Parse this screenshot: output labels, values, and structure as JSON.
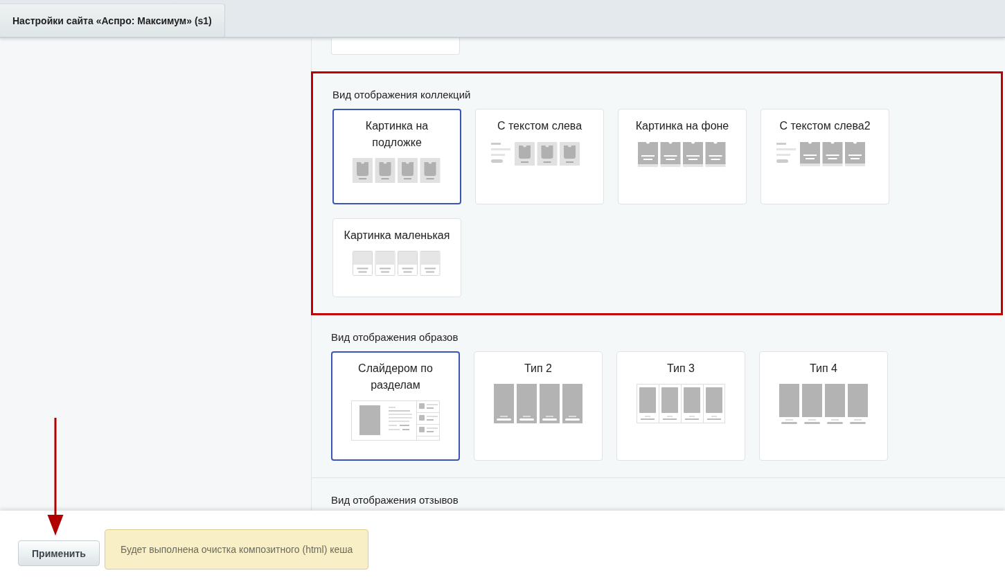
{
  "tab": {
    "label": "Настройки сайта «Аспро: Максимум» (s1)",
    "selected": true
  },
  "sections": [
    {
      "title": "Вид отображения коллекций",
      "highlighted": true,
      "options": [
        {
          "label": "Картинка на подложке",
          "kind": "plate",
          "selected": true
        },
        {
          "label": "С текстом слева",
          "kind": "text-left",
          "selected": false
        },
        {
          "label": "Картинка на фоне",
          "kind": "background",
          "selected": false
        },
        {
          "label": "С текстом слева2",
          "kind": "text-left-dark",
          "selected": false
        },
        {
          "label": "Картинка маленькая",
          "kind": "small",
          "selected": false
        }
      ]
    },
    {
      "title": "Вид отображения образов",
      "highlighted": false,
      "options": [
        {
          "label": "Слайдером по разделам",
          "kind": "slider",
          "selected": true
        },
        {
          "label": "Тип 2",
          "kind": "tall",
          "selected": false
        },
        {
          "label": "Тип 3",
          "kind": "framed",
          "selected": false
        },
        {
          "label": "Тип 4",
          "kind": "captioned",
          "selected": false
        }
      ]
    },
    {
      "title": "Вид отображения отзывов",
      "highlighted": false
    }
  ],
  "footer": {
    "apply_button": "Применить",
    "notice": "Будет выполнена очистка композитного (html) кеша"
  }
}
